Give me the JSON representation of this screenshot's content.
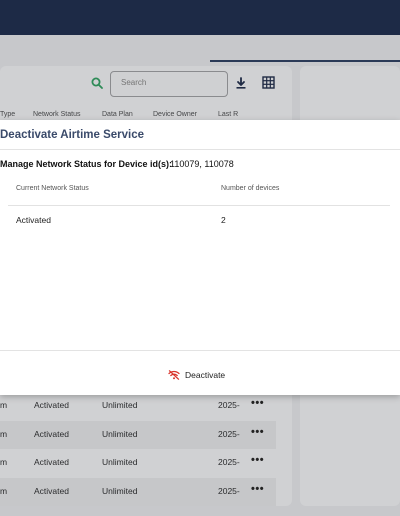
{
  "toolbar": {
    "search_placeholder": "Search"
  },
  "table": {
    "headers": [
      "Type",
      "Network Status",
      "Data Plan",
      "Device Owner",
      "Last R"
    ],
    "rows": [
      {
        "type": "m",
        "status": "Activated",
        "plan": "Unlimited",
        "last": "2025-"
      },
      {
        "type": "m",
        "status": "Activated",
        "plan": "Unlimited",
        "last": "2025-"
      },
      {
        "type": "m",
        "status": "Activated",
        "plan": "Unlimited",
        "last": "2025-"
      },
      {
        "type": "m",
        "status": "Activated",
        "plan": "Unlimited",
        "last": "2025-"
      }
    ],
    "more_glyph": "•••"
  },
  "modal": {
    "title": "Deactivate Airtime Service",
    "manage_label": "Manage Network Status for Device id(s):",
    "device_ids": "110079, 110078",
    "col_status": "Current Network Status",
    "col_count": "Number of devices",
    "row_status": "Activated",
    "row_count": "2",
    "deactivate_label": "Deactivate"
  },
  "colors": {
    "header_bg": "#1d2a46",
    "search_icon": "#2e8b57",
    "deactivate_icon": "#d9342b",
    "modal_title": "#3a4a6a"
  },
  "icons": [
    "search-icon",
    "download-icon",
    "grid-icon",
    "more-icon",
    "wifi-off-icon"
  ]
}
